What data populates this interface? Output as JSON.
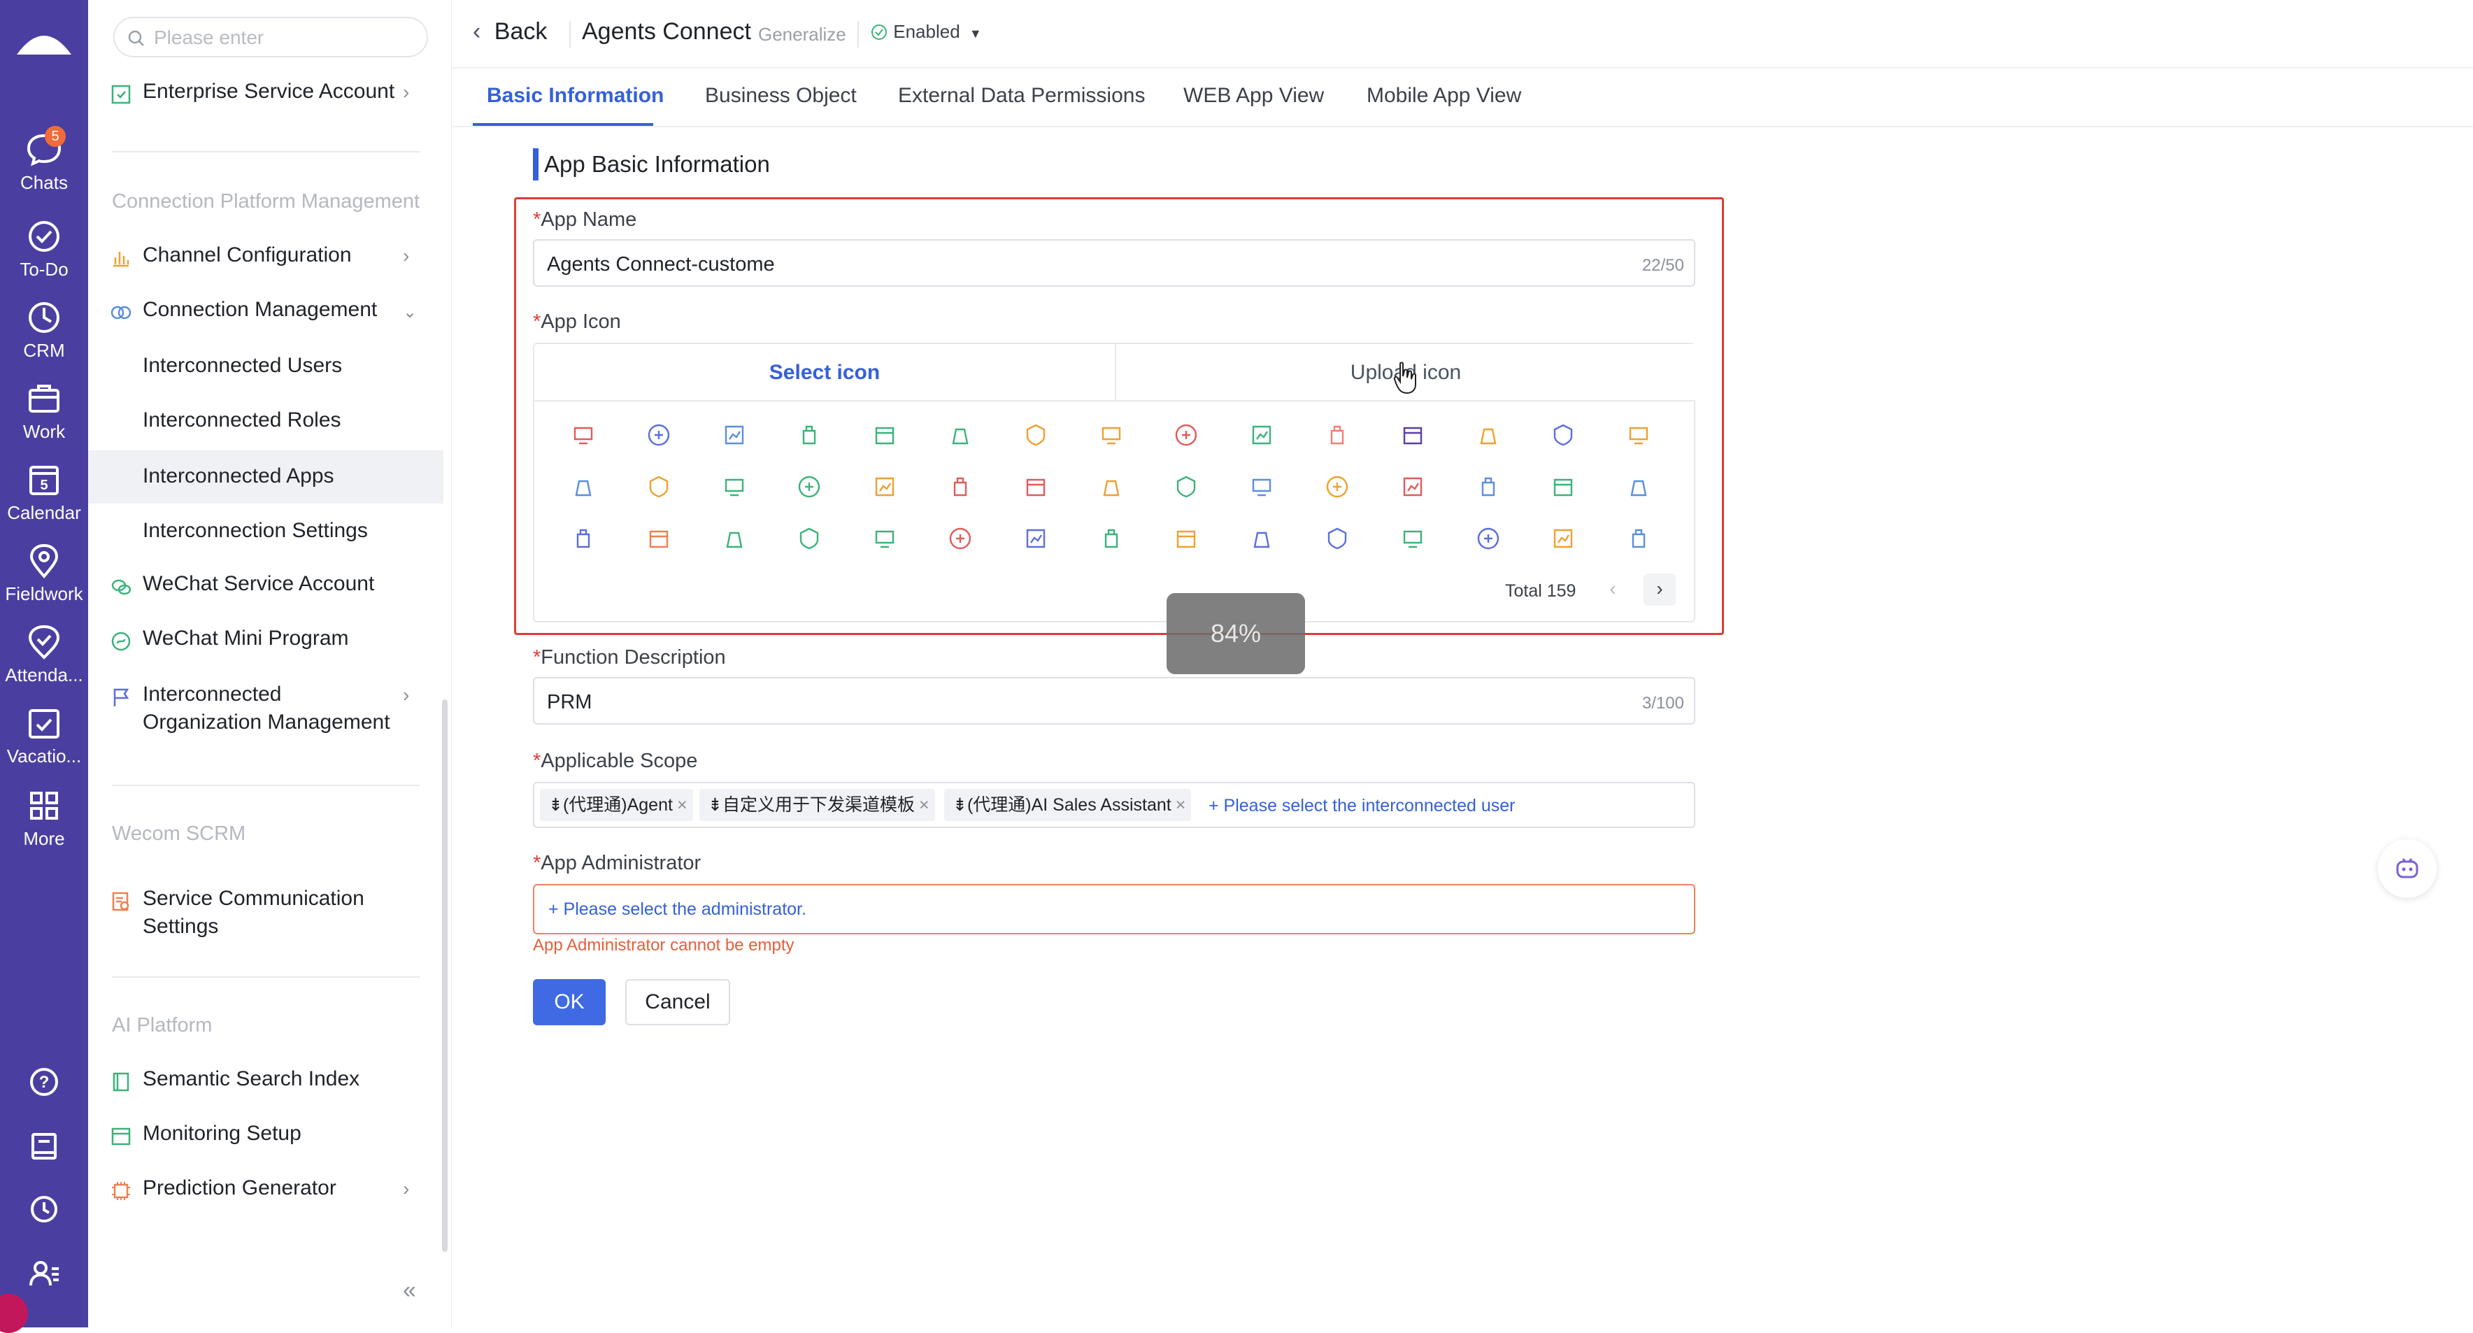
{
  "rail": {
    "items": [
      {
        "label": "Chats",
        "badge": "5",
        "icon": "chat-bubble-icon"
      },
      {
        "label": "To-Do",
        "icon": "check-circle-icon"
      },
      {
        "label": "CRM",
        "icon": "clock-pie-icon"
      },
      {
        "label": "Work",
        "icon": "briefcase-icon"
      },
      {
        "label": "Calendar",
        "icon": "calendar-icon",
        "day": "5"
      },
      {
        "label": "Fieldwork",
        "icon": "location-pin-icon"
      },
      {
        "label": "Attenda...",
        "icon": "attendance-icon"
      },
      {
        "label": "Vacatio...",
        "icon": "vacation-icon"
      },
      {
        "label": "More",
        "icon": "grid-icon"
      }
    ],
    "bottom_icons": [
      "help-icon",
      "notebook-icon",
      "history-icon",
      "contacts-icon"
    ]
  },
  "sidebar": {
    "search_placeholder": "Please enter",
    "enterprise_service_account": "Enterprise Service Account",
    "section_connection": "Connection Platform Management",
    "channel_configuration": "Channel Configuration",
    "connection_management": "Connection Management",
    "interconnected_users": "Interconnected Users",
    "interconnected_roles": "Interconnected Roles",
    "interconnected_apps": "Interconnected Apps",
    "interconnection_settings": "Interconnection Settings",
    "wechat_service_account": "WeChat Service  Account",
    "wechat_mini_program": "WeChat Mini Program",
    "interconnected_org_line1": "Interconnected",
    "interconnected_org_line2": "Organization Management",
    "section_wecom": "Wecom SCRM",
    "service_comm_line1": "Service Communication",
    "service_comm_line2": "Settings",
    "section_ai": "AI Platform",
    "semantic_search_index": "Semantic Search Index",
    "monitoring_setup": "Monitoring Setup",
    "prediction_generator": "Prediction Generator"
  },
  "header": {
    "back": "Back",
    "title": "Agents Connect",
    "generalize": "Generalize",
    "status": "Enabled"
  },
  "tabs": [
    "Basic Information",
    "Business Object",
    "External Data Permissions",
    "WEB App View",
    "Mobile App View"
  ],
  "form": {
    "section_title": "App Basic Information",
    "required_mark": "*",
    "app_name_label": "App Name",
    "app_name_value": "Agents Connect-custome",
    "app_name_count": "22/50",
    "app_icon_label": "App Icon",
    "select_icon_tab": "Select icon",
    "upload_icon_tab": "Upload icon",
    "icon_total": "Total 159",
    "progress_toast": "84%",
    "function_desc_label": "Function Description",
    "function_desc_value": "PRM",
    "function_desc_count": "3/100",
    "scope_label": "Applicable Scope",
    "scope_tags": [
      "(代理通)Agent",
      "自定义用于下发渠道模板",
      "(代理通)AI Sales Assistant"
    ],
    "scope_add": "+ Please select the interconnected user",
    "admin_label": "App Administrator",
    "admin_placeholder": "+ Please select the administrator.",
    "admin_error": "App Administrator cannot be empty",
    "ok": "OK",
    "cancel": "Cancel"
  },
  "icon_grid": {
    "colors": [
      [
        "#e05c5c",
        "#5a6ee0",
        "#5a8ee0",
        "#3bb37a",
        "#3bb37a",
        "#3bb37a",
        "#f0a030",
        "#f0a030",
        "#e05c5c",
        "#3bb37a",
        "#f08070",
        "#5a3ea8",
        "#f0a030",
        "#5a6ee0",
        "#f0a030"
      ],
      [
        "#5a8ee0",
        "#f0a030",
        "#3bb37a",
        "#3bb37a",
        "#f0a030",
        "#e05c5c",
        "#e05c5c",
        "#f0a030",
        "#3bb37a",
        "#5a8ee0",
        "#f0a030",
        "#e05c5c",
        "#5a8ee0",
        "#3bb37a",
        "#5a8ee0"
      ],
      [
        "#5a6ee0",
        "#f08050",
        "#3bb37a",
        "#3bb37a",
        "#3bb37a",
        "#e05c5c",
        "#5a6ee0",
        "#3bb37a",
        "#f0a030",
        "#5a6ee0",
        "#5a6ee0",
        "#3bb37a",
        "#5a6ee0",
        "#f0a030",
        "#5a8ee0"
      ]
    ]
  }
}
